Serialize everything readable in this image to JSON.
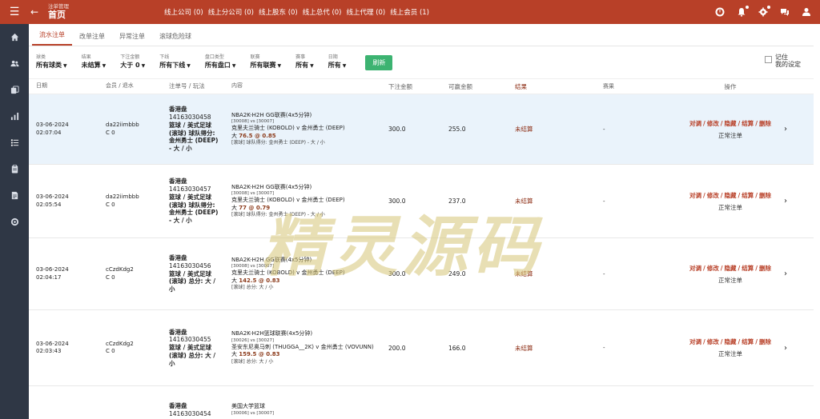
{
  "header": {
    "subtitle": "注单管理",
    "title": "首页",
    "links": [
      "线上公司 (0)",
      "线上分公司 (0)",
      "线上股东 (0)",
      "线上总代 (0)",
      "线上代理 (0)",
      "线上会员 (1)"
    ],
    "icons": [
      "speedometer-icon",
      "bell-icon",
      "settings-icon",
      "chat-icon",
      "user-icon"
    ]
  },
  "sidebar": {
    "icons": [
      "home-icon",
      "users-icon",
      "copy-icon",
      "bar-chart-icon",
      "list-icon",
      "clipboard-icon",
      "report-icon",
      "shield-icon"
    ]
  },
  "tabs": [
    "流水注单",
    "改单注单",
    "异常注单",
    "滚球危险球"
  ],
  "filters": [
    {
      "label": "球类",
      "value": "所有球类"
    },
    {
      "label": "结果",
      "value": "未结算"
    },
    {
      "label": "下注金额",
      "value": "大于 0"
    },
    {
      "label": "下线",
      "value": "所有下线"
    },
    {
      "label": "盘口类型",
      "value": "所有盘口"
    },
    {
      "label": "联赛",
      "value": "所有联赛"
    },
    {
      "label": "赛事",
      "value": "所有"
    },
    {
      "label": "日期",
      "value": "所有"
    }
  ],
  "refresh_label": "刷新",
  "remember_label": "记住\n我的设定",
  "columns": [
    "日期",
    "会员 / 退水",
    "注单号 / 玩法",
    "内容",
    "下注金额",
    "可赢金额",
    "结果",
    "赛果",
    "操作"
  ],
  "rows": [
    {
      "date": "03-06-2024",
      "time": "02:07:04",
      "member": "da22iimbbb",
      "rebate": "C 0",
      "market": "香港盘",
      "order_no": "14163030458",
      "play": [
        "篮球 / 美式足球",
        "(滚球) 球队得分:",
        "金州勇士 (DEEP)",
        "- 大 / 小"
      ],
      "league": "NBA2K-H2H GG联赛(4x5分钟)",
      "ids": "[30008] vs [30007]",
      "teams": "克里夫兰骑士 (KOBOLD) v 金州勇士 (DEEP)",
      "odds_prefix": "大 ",
      "odds": "76.5 @ 0.85",
      "detail": "[滚球] 球队得分: 金州勇士 (DEEP) - 大 / 小",
      "bet": "300.0",
      "win": "255.0",
      "result": "未结算",
      "game_result": "-",
      "highlight": true
    },
    {
      "date": "03-06-2024",
      "time": "02:05:54",
      "member": "da22iimbbb",
      "rebate": "C 0",
      "market": "香港盘",
      "order_no": "14163030457",
      "play": [
        "篮球 / 美式足球",
        "(滚球) 球队得分:",
        "金州勇士 (DEEP)",
        "- 大 / 小"
      ],
      "league": "NBA2K-H2H GG联赛(4x5分钟)",
      "ids": "[30008] vs [30007]",
      "teams": "克里夫兰骑士 (KOBOLD) v 金州勇士 (DEEP)",
      "odds_prefix": "大 ",
      "odds": "77 @ 0.79",
      "detail": "[滚球] 球队得分: 金州勇士 (DEEP) - 大 / 小",
      "bet": "300.0",
      "win": "237.0",
      "result": "未结算",
      "game_result": "-",
      "highlight": false
    },
    {
      "date": "03-06-2024",
      "time": "02:04:17",
      "member": "cCzdKdg2",
      "rebate": "C 0",
      "market": "香港盘",
      "order_no": "14163030456",
      "play": [
        "篮球 / 美式足球",
        "(滚球) 总分: 大 /",
        "小"
      ],
      "league": "NBA2K-H2H GG联赛(4x5分钟)",
      "ids": "[30008] vs [30007]",
      "teams": "克里夫兰骑士 (KOBOLD) v 金州勇士 (DEEP)",
      "odds_prefix": "大 ",
      "odds": "142.5 @ 0.83",
      "detail": "[滚球] 总分: 大 / 小",
      "bet": "300.0",
      "win": "249.0",
      "result": "未结算",
      "game_result": "-",
      "highlight": false
    },
    {
      "date": "03-06-2024",
      "time": "02:03:43",
      "member": "cCzdKdg2",
      "rebate": "C 0",
      "market": "香港盘",
      "order_no": "14163030455",
      "play": [
        "篮球 / 美式足球",
        "(滚球) 总分: 大 /",
        "小"
      ],
      "league": "NBA2K-H2H篮球联赛(4x5分钟)",
      "ids": "[30026] vs [30027]",
      "teams": "圣安东尼奥马刺 (THUGGA__2K) v 金州勇士 (VOVUNN)",
      "odds_prefix": "大 ",
      "odds": "159.5 @ 0.83",
      "detail": "[滚球] 总分: 大 / 小",
      "bet": "200.0",
      "win": "166.0",
      "result": "未结算",
      "game_result": "-",
      "highlight": false
    },
    {
      "date": "",
      "time": "",
      "member": "",
      "rebate": "",
      "market": "香港盘",
      "order_no": "14163030454",
      "play": [],
      "league": "美国大学篮球",
      "ids": "[30006] vs [30007]",
      "teams": "",
      "odds_prefix": "",
      "odds": "",
      "detail": "",
      "bet": "",
      "win": "",
      "result": "",
      "game_result": "",
      "highlight": false
    }
  ],
  "ops": [
    "对调",
    "修改",
    "隐藏",
    "结算",
    "删除"
  ],
  "ops_status": "正常注单",
  "watermark": "精灵源码"
}
